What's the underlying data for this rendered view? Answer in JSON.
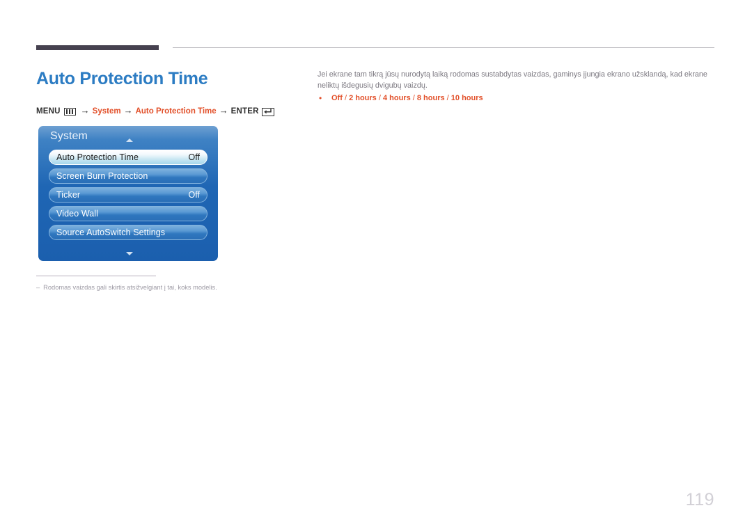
{
  "header": {
    "rule_dark_color": "#46414f",
    "rule_thin_color": "#b9b7bd"
  },
  "title": "Auto Protection Time",
  "title_color": "#2c7cc3",
  "breadcrumb": {
    "menu_label": "MENU",
    "menu_icon": "menu-bars-icon",
    "arrow": "→",
    "step_system": "System",
    "step_feature": "Auto Protection Time",
    "enter_label": "ENTER",
    "enter_icon": "enter-return-icon",
    "accent_color": "#e2502a"
  },
  "osd": {
    "title": "System",
    "scroll_up_icon": "triangle-up-icon",
    "scroll_down_icon": "triangle-down-icon",
    "rows": [
      {
        "label": "Auto Protection Time",
        "value": "Off",
        "selected": true
      },
      {
        "label": "Screen Burn Protection",
        "value": "",
        "selected": false
      },
      {
        "label": "Ticker",
        "value": "Off",
        "selected": false
      },
      {
        "label": "Video Wall",
        "value": "",
        "selected": false
      },
      {
        "label": "Source AutoSwitch Settings",
        "value": "",
        "selected": false
      }
    ]
  },
  "footnote": {
    "dash": "–",
    "text": "Rodomas vaizdas gali skirtis atsižvelgiant į tai, koks modelis."
  },
  "description": "Jei ekrane tam tikrą jūsų nurodytą laiką rodomas sustabdytas vaizdas, gaminys įjungia ekrano užsklandą, kad ekrane neliktų išdegusių dvigubų vaizdų.",
  "options": {
    "bullet": "•",
    "items": [
      "Off",
      "2 hours",
      "4 hours",
      "8 hours",
      "10 hours"
    ],
    "separator": " / ",
    "color": "#e2502a"
  },
  "page_number": "119"
}
